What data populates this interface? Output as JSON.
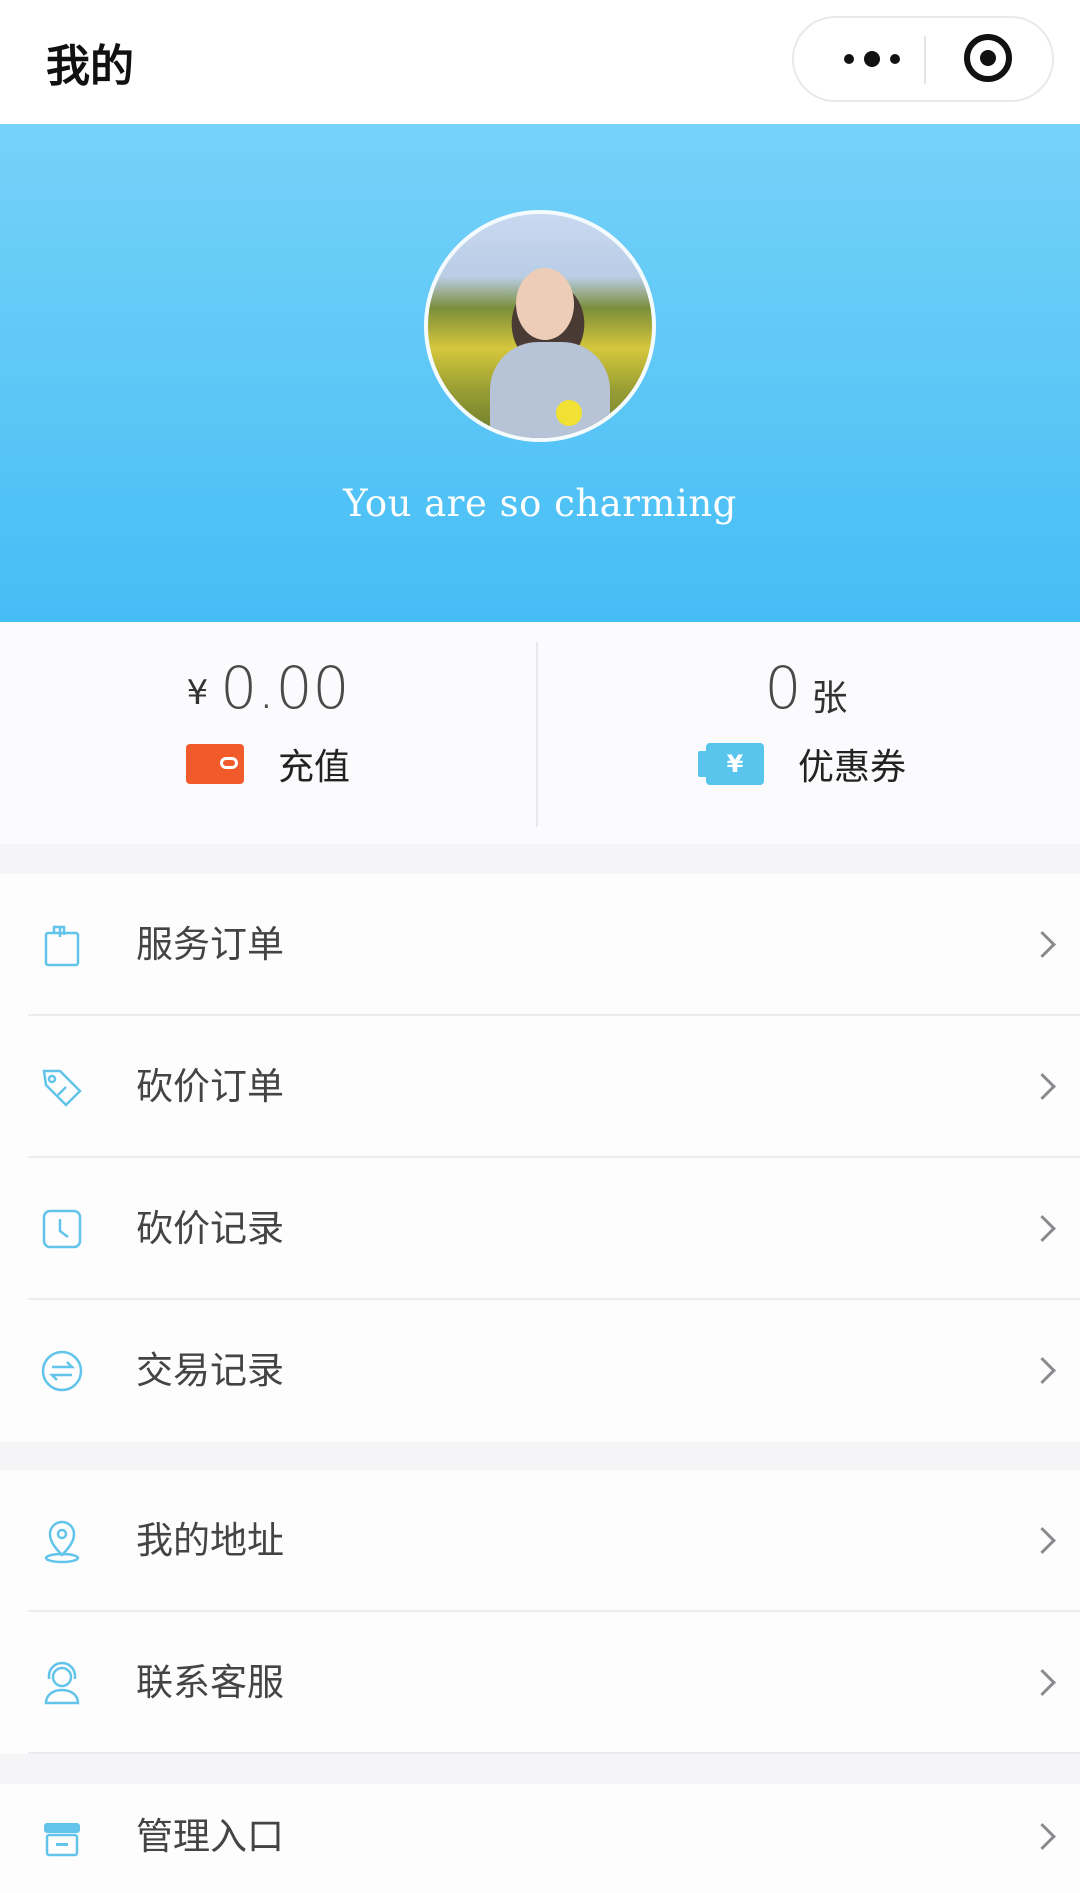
{
  "topbar": {
    "title": "我的"
  },
  "hero": {
    "slogan": "You are so charming"
  },
  "stats": {
    "balance": {
      "currency": "¥",
      "amount": "0.00",
      "action_label": "充值",
      "icon": "wallet-icon"
    },
    "coupons": {
      "count": "0",
      "unit": "张",
      "action_label": "优惠券",
      "icon": "coupon-icon"
    }
  },
  "menu_group_1": [
    {
      "label": "服务订单",
      "icon": "bag-icon"
    },
    {
      "label": "砍价订单",
      "icon": "tag-icon"
    },
    {
      "label": "砍价记录",
      "icon": "clock-icon"
    },
    {
      "label": "交易记录",
      "icon": "exchange-icon"
    }
  ],
  "menu_group_2": [
    {
      "label": "我的地址",
      "icon": "location-icon"
    },
    {
      "label": "联系客服",
      "icon": "headset-icon"
    }
  ],
  "menu_group_3": [
    {
      "label": "管理入口",
      "icon": "store-icon"
    }
  ],
  "colors": {
    "accent": "#45bdf5",
    "icon": "#62c4ea",
    "wallet": "#f15a2b"
  }
}
